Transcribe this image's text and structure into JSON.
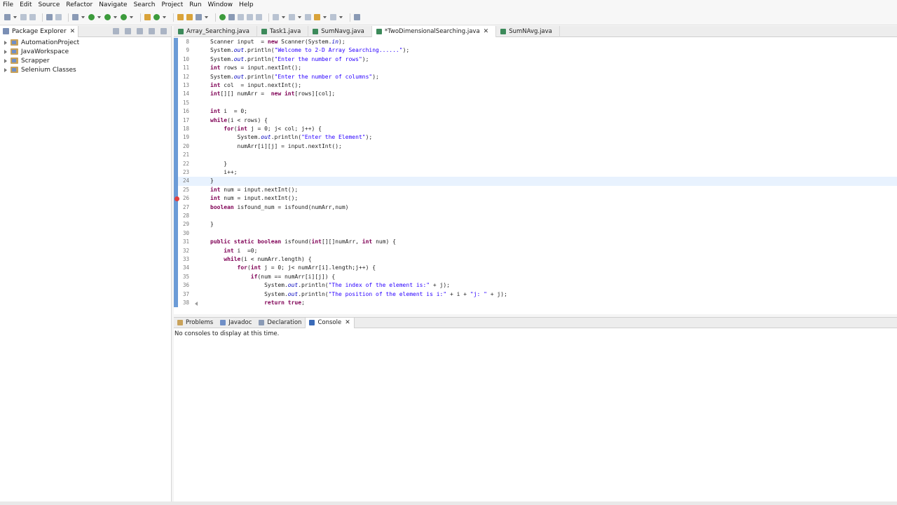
{
  "menu": [
    "File",
    "Edit",
    "Source",
    "Refactor",
    "Navigate",
    "Search",
    "Project",
    "Run",
    "Window",
    "Help"
  ],
  "package_explorer": {
    "title": "Package Explorer",
    "projects": [
      "AutomationProject",
      "JavaWorkspace",
      "Scrapper",
      "Selenium Classes"
    ]
  },
  "editor": {
    "tabs": [
      {
        "label": "Array_Searching.java",
        "active": false
      },
      {
        "label": "Task1.java",
        "active": false
      },
      {
        "label": "SumNavg.java",
        "active": false
      },
      {
        "label": "*TwoDimensionalSearching.java",
        "active": true
      },
      {
        "label": "SumNAvg.java",
        "active": false
      }
    ],
    "lines": [
      {
        "n": "8",
        "text": "Scanner input  = new Scanner(System.in);"
      },
      {
        "n": "9",
        "text": "System.out.println(\"Welcome to 2-D Array Searching......\");"
      },
      {
        "n": "10",
        "text": "System.out.println(\"Enter the number of rows\");"
      },
      {
        "n": "11",
        "text": "int rows = input.nextInt();"
      },
      {
        "n": "12",
        "text": "System.out.println(\"Enter the number of columns\");"
      },
      {
        "n": "13",
        "text": "int col  = input.nextInt();"
      },
      {
        "n": "14",
        "text": "int[][] numArr =  new int[rows][col];"
      },
      {
        "n": "15",
        "text": ""
      },
      {
        "n": "16",
        "text": "int i  = 0;"
      },
      {
        "n": "17",
        "text": "while(i < rows) {"
      },
      {
        "n": "18",
        "text": "    for(int j = 0; j< col; j++) {"
      },
      {
        "n": "19",
        "text": "        System.out.println(\"Enter the Element\");"
      },
      {
        "n": "20",
        "text": "        numArr[i][j] = input.nextInt();"
      },
      {
        "n": "21",
        "text": ""
      },
      {
        "n": "22",
        "text": "    }"
      },
      {
        "n": "23",
        "text": "    i++;"
      },
      {
        "n": "24",
        "text": "}"
      },
      {
        "n": "25",
        "text": "int num = input.nextInt();"
      },
      {
        "n": "26",
        "text": "int num = input.nextInt();"
      },
      {
        "n": "27",
        "text": "boolean isfound_num = isfound(numArr,num)"
      },
      {
        "n": "28",
        "text": ""
      },
      {
        "n": "29",
        "text": "}"
      },
      {
        "n": "30",
        "text": ""
      },
      {
        "n": "31",
        "text": "public static boolean isfound(int[][]numArr, int num) {"
      },
      {
        "n": "32",
        "text": "    int i  =0;"
      },
      {
        "n": "33",
        "text": "    while(i < numArr.length) {"
      },
      {
        "n": "34",
        "text": "        for(int j = 0; j< numArr[i].length;j++) {"
      },
      {
        "n": "35",
        "text": "            if(num == numArr[i][j]) {"
      },
      {
        "n": "36",
        "text": "                System.out.println(\"The index of the element is:\" + j);"
      },
      {
        "n": "37",
        "text": "                System.out.println(\"The position of the element is i:\" + i + \"j: \" + j);"
      },
      {
        "n": "38",
        "text": "                return true;"
      }
    ]
  },
  "bottom_panel": {
    "tabs": [
      {
        "label": "Problems",
        "active": false
      },
      {
        "label": "Javadoc",
        "active": false
      },
      {
        "label": "Declaration",
        "active": false
      },
      {
        "label": "Console",
        "active": true
      }
    ],
    "console_message": "No consoles to display at this time."
  }
}
